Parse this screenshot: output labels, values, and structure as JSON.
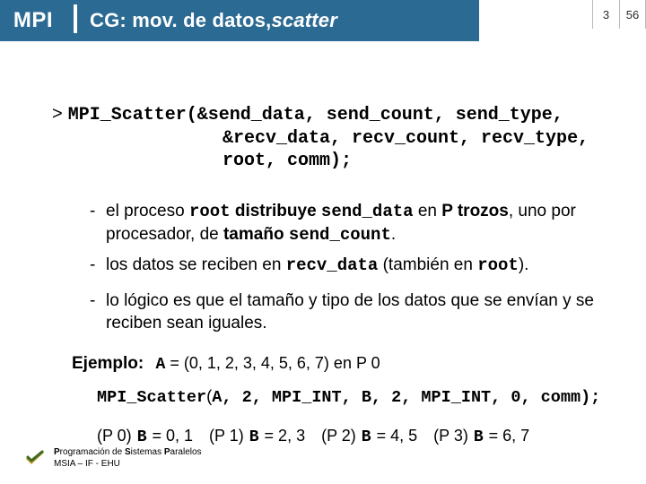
{
  "header": {
    "badge": "MPI",
    "title_prefix": "CG: mov. de datos, ",
    "title_italic": "scatter",
    "section": "3",
    "page": "56"
  },
  "proto": {
    "line1_pre": ">",
    "line1": "MPI_Scatter(&send_data, send_count, send_type,",
    "line2": "&recv_data, recv_count, recv_type,",
    "line3": "root, comm);"
  },
  "bullets": {
    "b1_a": "el proceso ",
    "b1_code1": "root",
    "b1_b": " distribuye ",
    "b1_code2": "send_data",
    "b1_c": " en ",
    "b1_bold1": "P trozos",
    "b1_d": ", uno por procesador, de ",
    "b1_bold2": "tamaño ",
    "b1_code3": "send_count",
    "b1_e": ".",
    "b2_a": "los datos se reciben en ",
    "b2_code1": "recv_data",
    "b2_b": " (también en ",
    "b2_code2": "root",
    "b2_c": ").",
    "b3": "lo lógico es que el tamaño y tipo de los datos que se envían y se reciben sean iguales."
  },
  "example": {
    "label": "Ejemplo",
    "array_code": "A",
    "array_text": " = (0, 1, 2, 3, 4, 5, 6, 7) en P 0",
    "call_fn": "MPI_Scatter",
    "call_args_open": "(",
    "call_args": "A, 2, MPI_INT, B, 2, MPI_INT, 0, comm);",
    "procs": [
      {
        "p": "(P 0) ",
        "var": "B",
        "vals": " = 0, 1"
      },
      {
        "p": "(P 1) ",
        "var": "B",
        "vals": " = 2, 3"
      },
      {
        "p": "(P 2) ",
        "var": "B",
        "vals": " = 4, 5"
      },
      {
        "p": "(P 3) ",
        "var": "B",
        "vals": " = 6, 7"
      }
    ]
  },
  "footer": {
    "line1_a": "P",
    "line1_b": "rogramación de ",
    "line1_c": "S",
    "line1_d": "istemas ",
    "line1_e": "P",
    "line1_f": "aralelos",
    "line2": "MSIA – IF - EHU"
  }
}
